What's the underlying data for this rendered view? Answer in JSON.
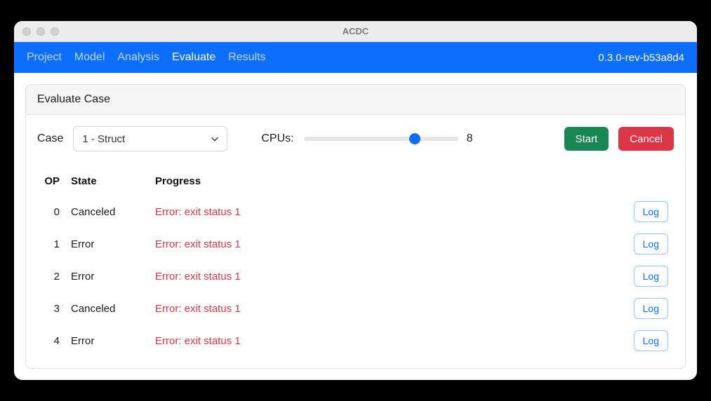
{
  "window": {
    "title": "ACDC"
  },
  "topnav": {
    "items": [
      {
        "label": "Project",
        "active": false
      },
      {
        "label": "Model",
        "active": false
      },
      {
        "label": "Analysis",
        "active": false
      },
      {
        "label": "Evaluate",
        "active": true
      },
      {
        "label": "Results",
        "active": false
      }
    ],
    "version": "0.3.0-rev-b53a8d4"
  },
  "panel": {
    "title": "Evaluate Case",
    "case_label": "Case",
    "case_value": "1 - Struct",
    "cpus_label": "CPUs:",
    "cpus_value": "8",
    "start_label": "Start",
    "cancel_label": "Cancel"
  },
  "table": {
    "headers": {
      "op": "OP",
      "state": "State",
      "progress": "Progress"
    },
    "log_label": "Log",
    "rows": [
      {
        "op": "0",
        "state": "Canceled",
        "progress": "Error: exit status 1"
      },
      {
        "op": "1",
        "state": "Error",
        "progress": "Error: exit status 1"
      },
      {
        "op": "2",
        "state": "Error",
        "progress": "Error: exit status 1"
      },
      {
        "op": "3",
        "state": "Canceled",
        "progress": "Error: exit status 1"
      },
      {
        "op": "4",
        "state": "Error",
        "progress": "Error: exit status 1"
      }
    ]
  }
}
